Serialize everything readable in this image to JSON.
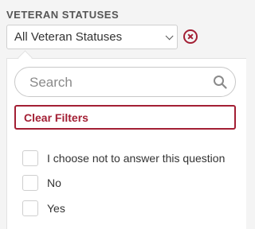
{
  "filter": {
    "label": "VETERAN STATUSES",
    "selected_value": "All Veteran Statuses"
  },
  "search": {
    "placeholder": "Search"
  },
  "clear_filters_label": "Clear Filters",
  "options": [
    {
      "label": "I choose not to answer this question",
      "checked": false
    },
    {
      "label": "No",
      "checked": false
    },
    {
      "label": "Yes",
      "checked": false
    }
  ],
  "colors": {
    "accent": "#a31f34",
    "label_gray": "#555555",
    "background": "#f4f4f4"
  },
  "icons": [
    "chevron-down-icon",
    "clear-icon",
    "search-icon"
  ]
}
